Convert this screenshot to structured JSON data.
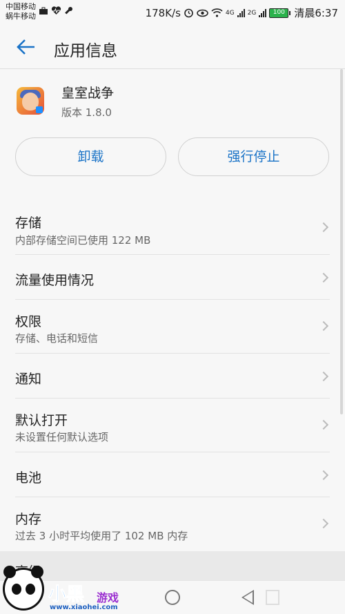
{
  "status_bar": {
    "carrier1": "中国移动",
    "carrier2": "蜗牛移动",
    "speed": "178K/s",
    "net1": "4G",
    "net2": "2G",
    "battery": "100",
    "time": "清晨6:37"
  },
  "header": {
    "title": "应用信息",
    "back_icon": "arrow-left"
  },
  "app": {
    "name": "皇室战争",
    "version": "版本 1.8.0"
  },
  "buttons": {
    "uninstall": "卸载",
    "force_stop": "强行停止"
  },
  "list": [
    {
      "label": "存储",
      "sub": "内部存储空间已使用 122 MB"
    },
    {
      "label": "流量使用情况",
      "sub": ""
    },
    {
      "label": "权限",
      "sub": "存储、电话和短信"
    },
    {
      "label": "通知",
      "sub": ""
    },
    {
      "label": "默认打开",
      "sub": "未设置任何默认选项"
    },
    {
      "label": "电池",
      "sub": ""
    },
    {
      "label": "内存",
      "sub": "过去 3 小时平均使用了 102 MB 内存"
    }
  ],
  "advanced": {
    "label": "高级"
  },
  "watermark": {
    "text": "小黑",
    "text2": "游戏",
    "url": "www.xiaohei.com"
  },
  "colors": {
    "accent": "#1a73c7",
    "background": "#f7f7f7"
  }
}
